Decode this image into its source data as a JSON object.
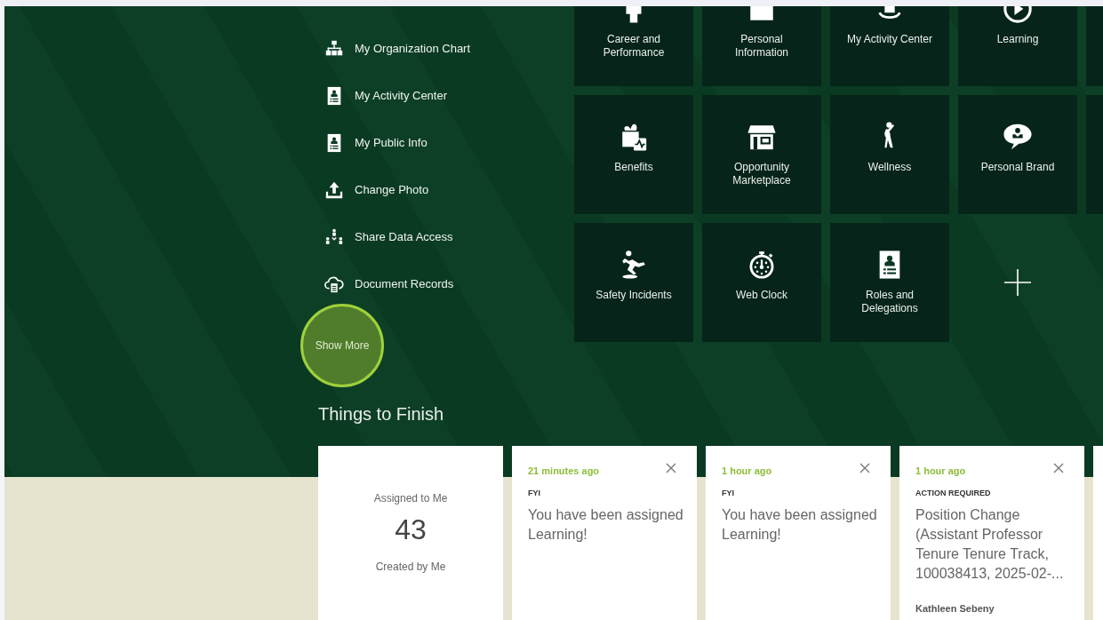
{
  "quick_actions": [
    {
      "label": "My Organization Chart"
    },
    {
      "label": "My Activity Center"
    },
    {
      "label": "My Public Info"
    },
    {
      "label": "Change Photo"
    },
    {
      "label": "Share Data Access"
    },
    {
      "label": "Document Records"
    }
  ],
  "show_more": {
    "label": "Show More"
  },
  "tiles": [
    {
      "kind": "app",
      "label": "Career and Performance"
    },
    {
      "kind": "app",
      "label": "Personal Information"
    },
    {
      "kind": "app",
      "label": "My Activity Center"
    },
    {
      "kind": "app",
      "label": "Learning"
    },
    {
      "kind": "edge"
    },
    {
      "kind": "app",
      "label": "Benefits"
    },
    {
      "kind": "app",
      "label": "Opportunity Marketplace"
    },
    {
      "kind": "app",
      "label": "Wellness"
    },
    {
      "kind": "app",
      "label": "Personal Brand"
    },
    {
      "kind": "edge"
    },
    {
      "kind": "app",
      "label": "Safety Incidents"
    },
    {
      "kind": "app",
      "label": "Web Clock"
    },
    {
      "kind": "app",
      "label": "Roles and Delegations"
    },
    {
      "kind": "add"
    }
  ],
  "things_to_finish": {
    "title": "Things to Finish",
    "summary": [
      {
        "label": "Assigned to Me",
        "count": "43"
      },
      {
        "label": "Created by Me"
      }
    ],
    "tasks": [
      {
        "time": "21 minutes ago",
        "category": "FYI",
        "message": "You have been assigned Learning!"
      },
      {
        "time": "1 hour ago",
        "category": "FYI",
        "message": "You have been assigned Learning!"
      },
      {
        "time": "1 hour ago",
        "category": "ACTION REQUIRED",
        "message": "Position Change (Assistant Professor Tenure Tenure Track, 100038413, 2025-02-...",
        "author": "Kathleen Sebeny"
      }
    ]
  }
}
